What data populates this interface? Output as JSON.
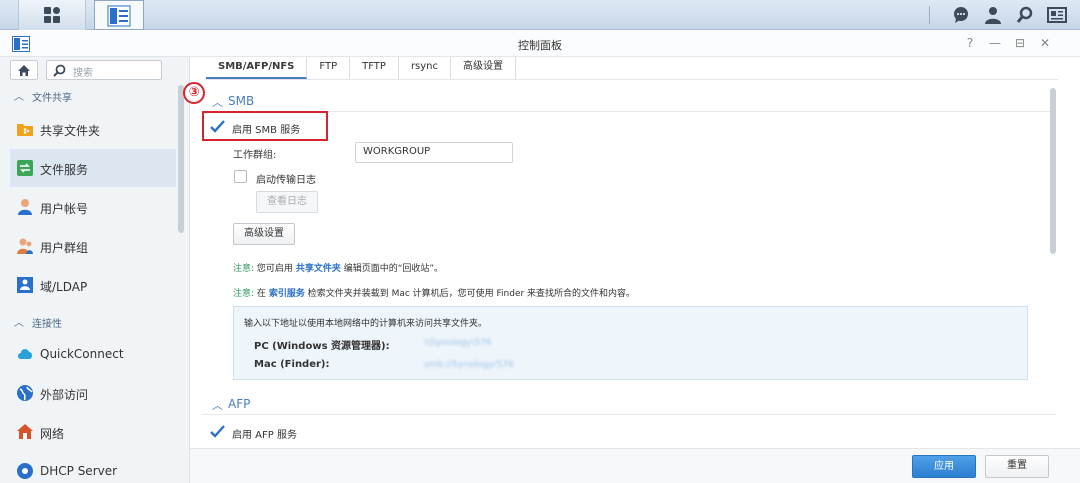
{
  "taskbar": {
    "apps_icon": "grid-icon",
    "cp_icon": "control-panel-icon",
    "right_icons": [
      "chat-icon",
      "user-icon",
      "search-icon",
      "widgets-icon"
    ]
  },
  "window": {
    "title": "控制面板",
    "controls": [
      "?",
      "—",
      "⊟",
      "✕"
    ]
  },
  "sidebar": {
    "search_placeholder": "搜索",
    "categories": {
      "file_sharing": "文件共享",
      "connectivity": "连接性"
    },
    "items": [
      {
        "label": "共享文件夹",
        "icon": "shared-folder-icon",
        "color": "#f0a21a"
      },
      {
        "label": "文件服务",
        "icon": "file-services-icon",
        "color": "#3aa757"
      },
      {
        "label": "用户帐号",
        "icon": "user-icon",
        "color": "#e07b39"
      },
      {
        "label": "用户群组",
        "icon": "user-group-icon",
        "color": "#e07b39"
      },
      {
        "label": "域/LDAP",
        "icon": "domain-icon",
        "color": "#2a6fc9"
      },
      {
        "label": "QuickConnect",
        "icon": "quickconnect-icon",
        "color": "#27a3d9"
      },
      {
        "label": "外部访问",
        "icon": "globe-icon",
        "color": "#2a6fc9"
      },
      {
        "label": "网络",
        "icon": "network-icon",
        "color": "#d9532a"
      },
      {
        "label": "DHCP Server",
        "icon": "dhcp-icon",
        "color": "#2a6fc9"
      }
    ]
  },
  "tabs": [
    "SMB/AFP/NFS",
    "FTP",
    "TFTP",
    "rsync",
    "高级设置"
  ],
  "smb": {
    "title": "SMB",
    "step_marker": "③",
    "enable_label": "启用 SMB 服务",
    "workgroup_label": "工作群组:",
    "workgroup_value": "WORKGROUP",
    "transfer_log_label": "启动传输日志",
    "view_log_button": "查看日志",
    "advanced_button": "高级设置",
    "note1": {
      "prefix": "注意:",
      "a": "您可启用",
      "link": "共享文件夹",
      "b": "编辑页面中的“回收站”。"
    },
    "note2": {
      "prefix": "注意:",
      "a": "在",
      "link": "索引服务",
      "b": "检索文件夹并装载到 Mac 计算机后，您可使用 Finder 来查找所合的文件和内容。"
    },
    "info": {
      "text": "输入以下地址以使用本地网络中的计算机来访问共享文件夹。",
      "pc_label": "PC (Windows 资源管理器):",
      "pc_value": "\\\\Synology\\576",
      "mac_label": "Mac (Finder):",
      "mac_value": "smb://Synology/576"
    }
  },
  "afp": {
    "title": "AFP",
    "enable_label": "启用 AFP 服务"
  },
  "footer": {
    "apply": "应用",
    "reset": "重置"
  },
  "colors": {
    "accent": "#4a7dbf",
    "highlight": "#d9232e",
    "note_green": "#2f9a5d",
    "link_blue": "#2a6fc9"
  }
}
